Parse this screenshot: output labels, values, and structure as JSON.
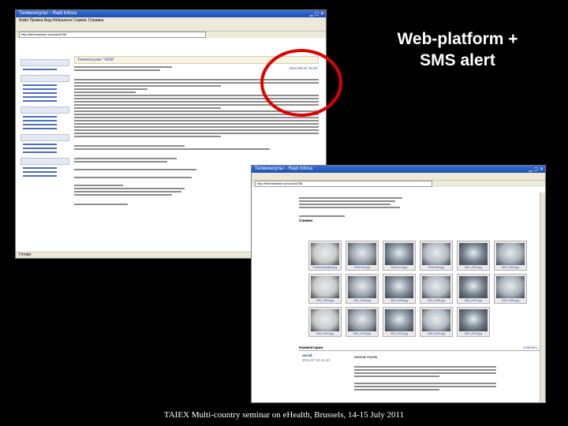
{
  "slide": {
    "title_line1": "Web-platform +",
    "title_line2": "SMS alert",
    "footer": "TAIEX Multi-country seminar on eHealth, Brussels, 14-15 July 2011"
  },
  "colors": {
    "background": "#000000",
    "highlight_circle": "#e00000",
    "title_text": "#ffffff"
  },
  "back_window": {
    "title": "Телеконсульт - Radi Infoca",
    "menu": "Файл  Правка  Вид  Избранное  Сервис  Справка",
    "address": "http://telemedicine.kz/cons/4296",
    "consult_header": "Телеконсульт \"4296\"",
    "date_stamp": "2010-09-02 15:29",
    "status": "Готово"
  },
  "front_window": {
    "title": "Телеконсульт - Radi Infoca",
    "address": "http://telemedicine.kz/cons/4296",
    "section_images": "Снимки",
    "section_comments": "Комментарии",
    "comment_author": "ангий",
    "comment_date": "2011-07-15 11:43",
    "comment_greeting": "Шапом салем,",
    "reply_link": "ответить",
    "image_captions": [
      "Ренгенография.jpg",
      "Рентген2.jpg",
      "Рентген3.jpg",
      "Рентген4.jpg",
      "IMG_0001.jpg",
      "IMG_0002.jpg",
      "IMG_0003.jpg",
      "IMG_0004.jpg",
      "IMG_0005.jpg",
      "IMG_0006.jpg",
      "IMG_0007.jpg",
      "IMG_0008.jpg",
      "IMG_0009.jpg",
      "IMG_0010.jpg",
      "IMG_0011.jpg",
      "IMG_0012.jpg",
      "IMG_0013.jpg"
    ]
  }
}
